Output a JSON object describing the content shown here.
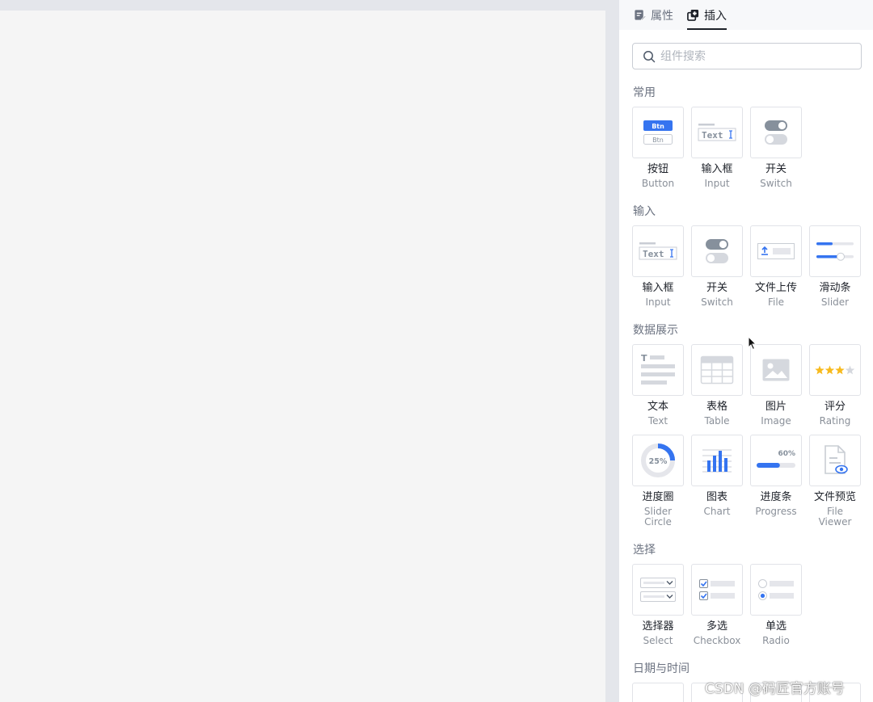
{
  "tabs": {
    "properties": "属性",
    "insert": "插入"
  },
  "search": {
    "placeholder": "组件搜索",
    "value": ""
  },
  "sections": {
    "common": {
      "title": "常用",
      "items": [
        {
          "zh": "按钮",
          "en": "Button",
          "icon": "button-icon"
        },
        {
          "zh": "输入框",
          "en": "Input",
          "icon": "input-icon"
        },
        {
          "zh": "开关",
          "en": "Switch",
          "icon": "switch-icon"
        }
      ]
    },
    "input": {
      "title": "输入",
      "items": [
        {
          "zh": "输入框",
          "en": "Input",
          "icon": "input-icon"
        },
        {
          "zh": "开关",
          "en": "Switch",
          "icon": "switch-icon"
        },
        {
          "zh": "文件上传",
          "en": "File",
          "icon": "file-upload-icon"
        },
        {
          "zh": "滑动条",
          "en": "Slider",
          "icon": "slider-icon"
        }
      ]
    },
    "display": {
      "title": "数据展示",
      "items": [
        {
          "zh": "文本",
          "en": "Text",
          "icon": "text-icon"
        },
        {
          "zh": "表格",
          "en": "Table",
          "icon": "table-icon"
        },
        {
          "zh": "图片",
          "en": "Image",
          "icon": "image-icon"
        },
        {
          "zh": "评分",
          "en": "Rating",
          "icon": "rating-icon",
          "stars_filled": 3,
          "stars_total": 4
        },
        {
          "zh": "进度圈",
          "en": "Slider Circle",
          "icon": "progress-circle-icon",
          "label": "25%",
          "value": 0.25
        },
        {
          "zh": "图表",
          "en": "Chart",
          "icon": "chart-icon"
        },
        {
          "zh": "进度条",
          "en": "Progress",
          "icon": "progress-bar-icon",
          "label": "60%",
          "value": 0.6
        },
        {
          "zh": "文件预览",
          "en": "File Viewer",
          "icon": "file-viewer-icon"
        }
      ]
    },
    "select": {
      "title": "选择",
      "items": [
        {
          "zh": "选择器",
          "en": "Select",
          "icon": "select-icon"
        },
        {
          "zh": "多选",
          "en": "Checkbox",
          "icon": "checkbox-icon"
        },
        {
          "zh": "单选",
          "en": "Radio",
          "icon": "radio-icon"
        }
      ]
    },
    "datetime": {
      "title": "日期与时间"
    }
  },
  "icon_labels": {
    "btn_primary": "Btn",
    "btn_secondary": "Btn",
    "text_field": "Text",
    "text_glyph": "T"
  },
  "watermark": "CSDN @码匠官方账号",
  "colors": {
    "accent": "#3574f0",
    "star": "#f7ba1e",
    "icon_gray": "#d5d8de",
    "toggle_dark": "#86909c"
  }
}
